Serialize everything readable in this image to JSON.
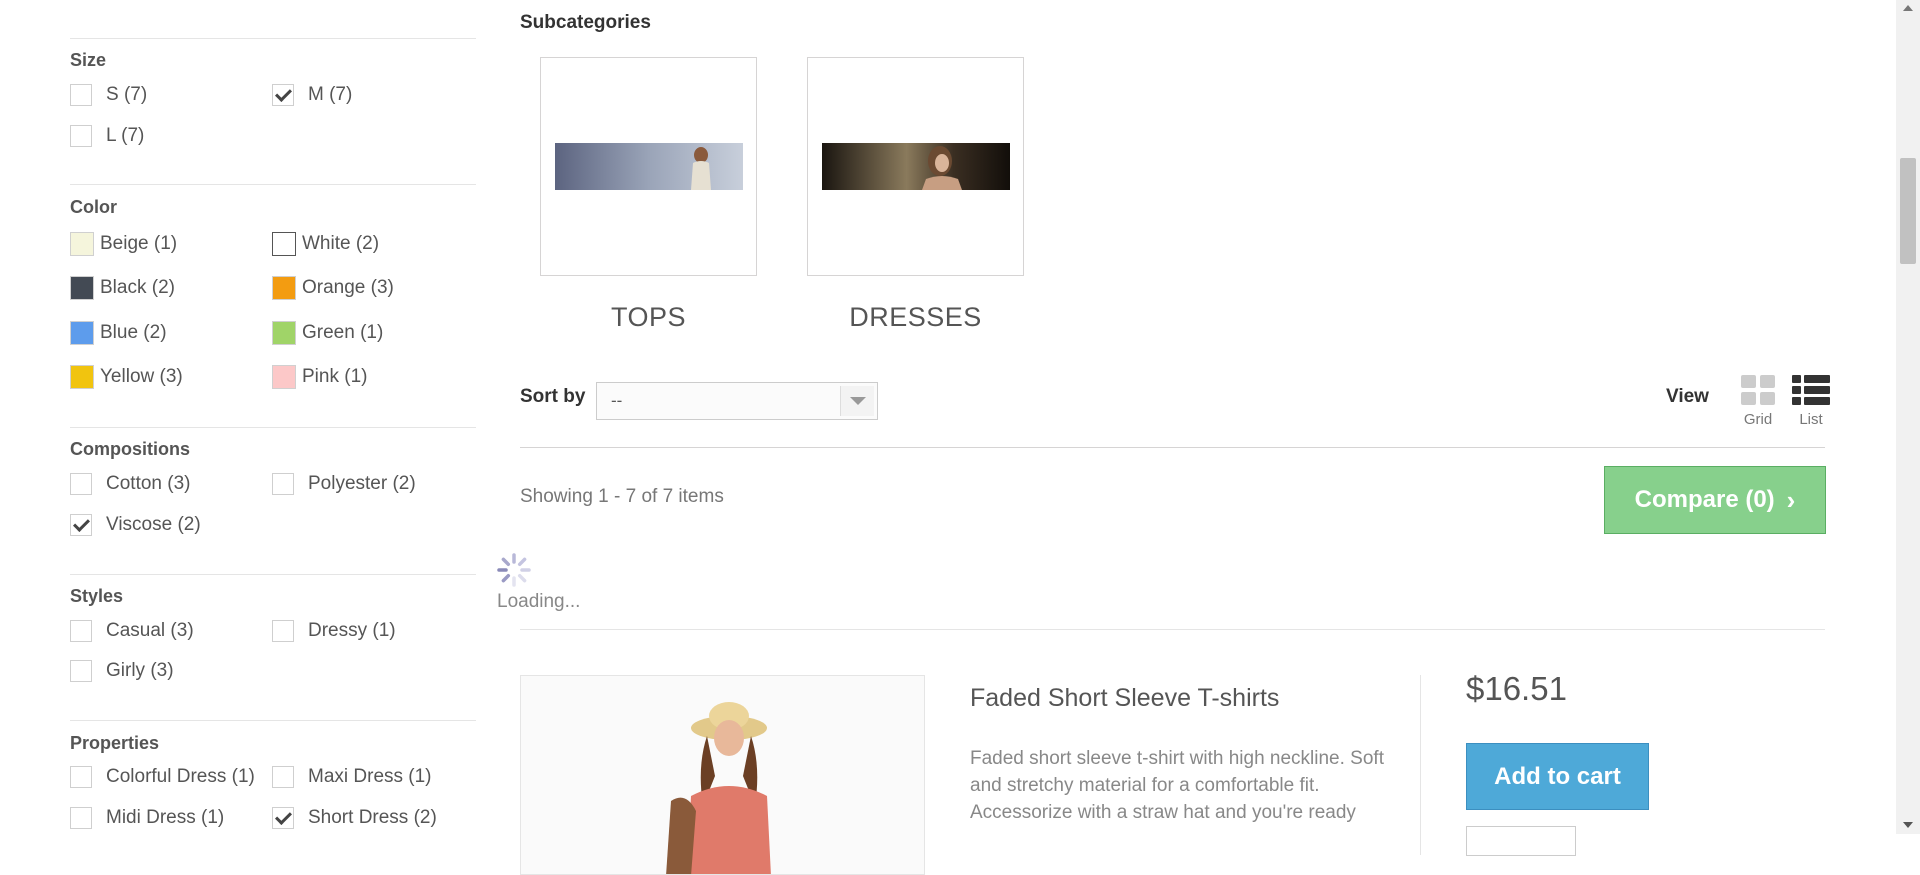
{
  "filters": {
    "size": {
      "title": "Size",
      "options": [
        {
          "label": "S (7)",
          "checked": false
        },
        {
          "label": "M (7)",
          "checked": true
        },
        {
          "label": "L (7)",
          "checked": false
        }
      ]
    },
    "color": {
      "title": "Color",
      "options": [
        {
          "label": "Beige (1)",
          "swatch": "#f5f5dc"
        },
        {
          "label": "White (2)",
          "swatch": "#ffffff"
        },
        {
          "label": "Black (2)",
          "swatch": "#434a54"
        },
        {
          "label": "Orange (3)",
          "swatch": "#f39c11"
        },
        {
          "label": "Blue (2)",
          "swatch": "#5d9cec"
        },
        {
          "label": "Green (1)",
          "swatch": "#a0d468"
        },
        {
          "label": "Yellow (3)",
          "swatch": "#f1c40f"
        },
        {
          "label": "Pink (1)",
          "swatch": "#fcc8c8"
        }
      ]
    },
    "compositions": {
      "title": "Compositions",
      "options": [
        {
          "label": "Cotton (3)",
          "checked": false
        },
        {
          "label": "Polyester (2)",
          "checked": false
        },
        {
          "label": "Viscose (2)",
          "checked": true
        }
      ]
    },
    "styles": {
      "title": "Styles",
      "options": [
        {
          "label": "Casual (3)",
          "checked": false
        },
        {
          "label": "Dressy (1)",
          "checked": false
        },
        {
          "label": "Girly (3)",
          "checked": false
        }
      ]
    },
    "properties": {
      "title": "Properties",
      "options": [
        {
          "label": "Colorful Dress (1)",
          "checked": false
        },
        {
          "label": "Maxi Dress (1)",
          "checked": false
        },
        {
          "label": "Midi Dress (1)",
          "checked": false
        },
        {
          "label": "Short Dress (2)",
          "checked": true
        }
      ]
    }
  },
  "subcategories": {
    "heading": "Subcategories",
    "items": [
      {
        "label": "TOPS"
      },
      {
        "label": "DRESSES"
      }
    ]
  },
  "toolbar": {
    "sort_label": "Sort by",
    "sort_value": "--",
    "view_label": "View",
    "grid_label": "Grid",
    "list_label": "List"
  },
  "listing": {
    "showing_text": "Showing 1 - 7 of 7 items",
    "compare_label": "Compare (0)",
    "loading_text": "Loading..."
  },
  "product": {
    "name": "Faded Short Sleeve T-shirts",
    "description": "Faded short sleeve t-shirt with high neckline. Soft and stretchy material for a comfortable fit. Accessorize with a straw hat and you're ready",
    "price": "$16.51",
    "add_to_cart_label": "Add to cart"
  },
  "colors": {
    "compare_green": "#87d08c",
    "cart_blue": "#4ea9d8",
    "view_active": "#333333",
    "view_inactive": "#cccccc"
  }
}
